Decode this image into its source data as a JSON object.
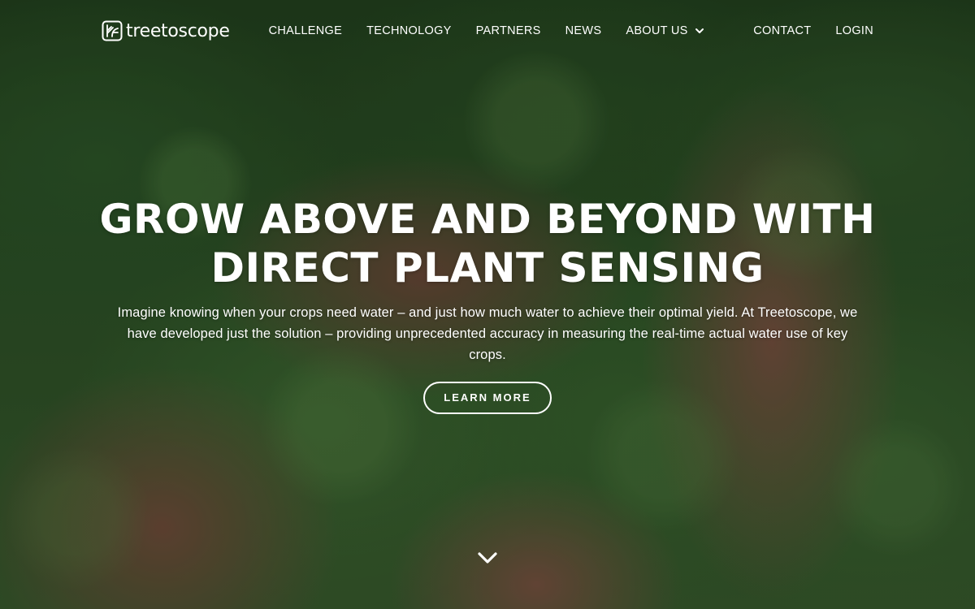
{
  "brand": {
    "name": "treetoscope",
    "logo_icon": "treetoscope-logo-mark"
  },
  "nav": {
    "items": [
      {
        "label": "CHALLENGE"
      },
      {
        "label": "TECHNOLOGY"
      },
      {
        "label": "PARTNERS"
      },
      {
        "label": "NEWS"
      },
      {
        "label": "ABOUT US",
        "icon": "chevron-down-icon"
      }
    ],
    "right": [
      {
        "label": "CONTACT"
      },
      {
        "label": "LOGIN"
      }
    ]
  },
  "hero": {
    "headline": "GROW ABOVE AND BEYOND WITH DIRECT PLANT SENSING",
    "subtext": "Imagine knowing when your crops need water – and just how much water to achieve their optimal yield. At Treetoscope, we have developed just the solution – providing unprecedented accuracy in measuring the real-time actual water use of key crops.",
    "cta_label": "LEARN MORE",
    "scroll_icon": "chevron-down-icon"
  },
  "colors": {
    "text": "#ffffff",
    "canopy_dark": "#24441f",
    "soil": "#7a5442"
  }
}
